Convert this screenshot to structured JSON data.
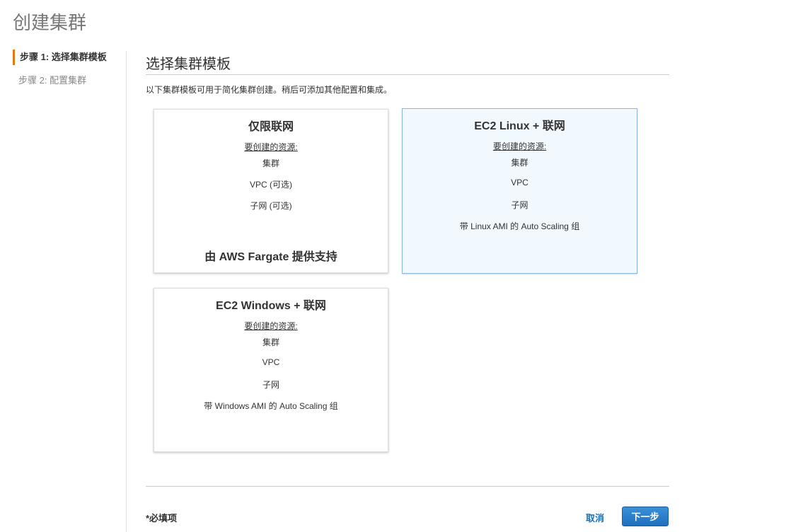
{
  "page": {
    "title": "创建集群"
  },
  "steps": [
    {
      "label": "步骤 1: 选择集群模板",
      "active": true
    },
    {
      "label": "步骤 2: 配置集群",
      "active": false
    }
  ],
  "section": {
    "title": "选择集群模板",
    "description": "以下集群模板可用于简化集群创建。稍后可添加其他配置和集成。"
  },
  "templates": [
    {
      "title": "仅限联网",
      "subtitle": "要创建的资源:",
      "resources": [
        "集群",
        "VPC (可选)",
        "子网 (可选)"
      ],
      "footer": "由 AWS Fargate 提供支持",
      "selected": false
    },
    {
      "title": "EC2 Linux + 联网",
      "subtitle": "要创建的资源:",
      "resources": [
        "集群",
        "VPC",
        "子网",
        "带 Linux AMI 的 Auto Scaling 组"
      ],
      "selected": true
    },
    {
      "title": "EC2 Windows + 联网",
      "subtitle": "要创建的资源:",
      "resources": [
        "集群",
        "VPC",
        "子网",
        "带 Windows AMI 的 Auto Scaling 组"
      ],
      "selected": false
    }
  ],
  "footer": {
    "required_note": "*必填项",
    "cancel_label": "取消",
    "next_label": "下一步"
  }
}
